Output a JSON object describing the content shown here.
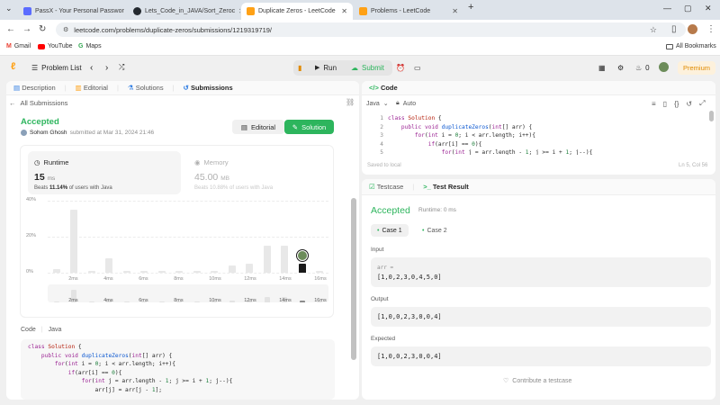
{
  "browser": {
    "tabs": [
      {
        "title": "PassX - Your Personal Passwor",
        "color": "#5b6cff"
      },
      {
        "title": "Lets_Code_in_JAVA/Sort_Zeroc",
        "color": "#24292f"
      },
      {
        "title": "Duplicate Zeros - LeetCode",
        "color": "#ffa116"
      },
      {
        "title": "Problems - LeetCode",
        "color": "#ffa116"
      }
    ],
    "url": "leetcode.com/problems/duplicate-zeros/submissions/1219319719/",
    "bookmarks": [
      {
        "label": "Gmail",
        "color": "#ea4335"
      },
      {
        "label": "YouTube",
        "color": "#ff0000"
      },
      {
        "label": "Maps",
        "color": "#34a853"
      }
    ],
    "all_bookmarks": "All Bookmarks"
  },
  "lcnav": {
    "problem_list": "Problem List",
    "run": "Run",
    "submit": "Submit",
    "streak": "0",
    "premium": "Premium"
  },
  "left": {
    "tabs": [
      "Description",
      "Editorial",
      "Solutions",
      "Submissions"
    ],
    "back": "All Submissions",
    "status": "Accepted",
    "author": "Sohom Ghosh",
    "submitted": "submitted at Mar 31, 2024 21:46",
    "editorial_btn": "Editorial",
    "solution_btn": "Solution",
    "runtime": {
      "label": "Runtime",
      "value": "15",
      "unit": "ms",
      "beats_prefix": "Beats",
      "beats": "11.14%",
      "beats_suffix": "of users with Java"
    },
    "memory": {
      "label": "Memory",
      "value": "45.00",
      "unit": "MB",
      "beats_prefix": "Beats",
      "beats": "10.88%",
      "beats_suffix": "of users with Java"
    },
    "code_label": "Code",
    "code_lang": "Java",
    "code_lines": [
      "class Solution {",
      "    public void duplicateZeros(int[] arr) {",
      "        for(int i = 0; i < arr.length; i++){",
      "            if(arr[i] == 0){",
      "                for(int j = arr.length - 1; j >= i + 1; j--){",
      "                    arr[j] = arr[j - 1];"
    ]
  },
  "chart_data": {
    "type": "bar",
    "ylabel": "",
    "yticks": [
      "40%",
      "20%",
      "0%"
    ],
    "ylim": [
      0,
      40
    ],
    "categories": [
      "1ms",
      "2ms",
      "3ms",
      "4ms",
      "5ms",
      "6ms",
      "7ms",
      "8ms",
      "9ms",
      "10ms",
      "11ms",
      "12ms",
      "13ms",
      "14ms",
      "15ms",
      "16ms"
    ],
    "xtick_labels": [
      "2ms",
      "4ms",
      "6ms",
      "8ms",
      "10ms",
      "12ms",
      "14ms",
      "16ms"
    ],
    "values": [
      2,
      35,
      0.5,
      8,
      0.5,
      1,
      1,
      1,
      1,
      1,
      4,
      5,
      15,
      15,
      5,
      0.5
    ],
    "highlight_index": 14,
    "bar_color": "#e8e8e8",
    "highlight_color": "#1a1a1a"
  },
  "right": {
    "code_tab": "Code",
    "lang": "Java",
    "auto": "Auto",
    "line_numbers": [
      "1",
      "2",
      "3",
      "4",
      "5"
    ],
    "code_lines": [
      "class Solution {",
      "    public void duplicateZeros(int[] arr) {",
      "        for(int i = 0; i < arr.length; i++){",
      "            if(arr[i] == 0){",
      "                for(int j = arr.length - 1; j >= i + 1; j--){"
    ],
    "saved": "Saved to local",
    "cursor": "Ln 5, Col 56",
    "testcase_tab": "Testcase",
    "result_tab": "Test Result",
    "result_status": "Accepted",
    "result_runtime": "Runtime: 0 ms",
    "cases": [
      "Case 1",
      "Case 2"
    ],
    "input_label": "Input",
    "input_var": "arr =",
    "input_value": "[1,0,2,3,0,4,5,0]",
    "output_label": "Output",
    "output_value": "[1,0,0,2,3,0,0,4]",
    "expected_label": "Expected",
    "expected_value": "[1,0,0,2,3,0,0,4]",
    "contribute": "Contribute a testcase"
  }
}
